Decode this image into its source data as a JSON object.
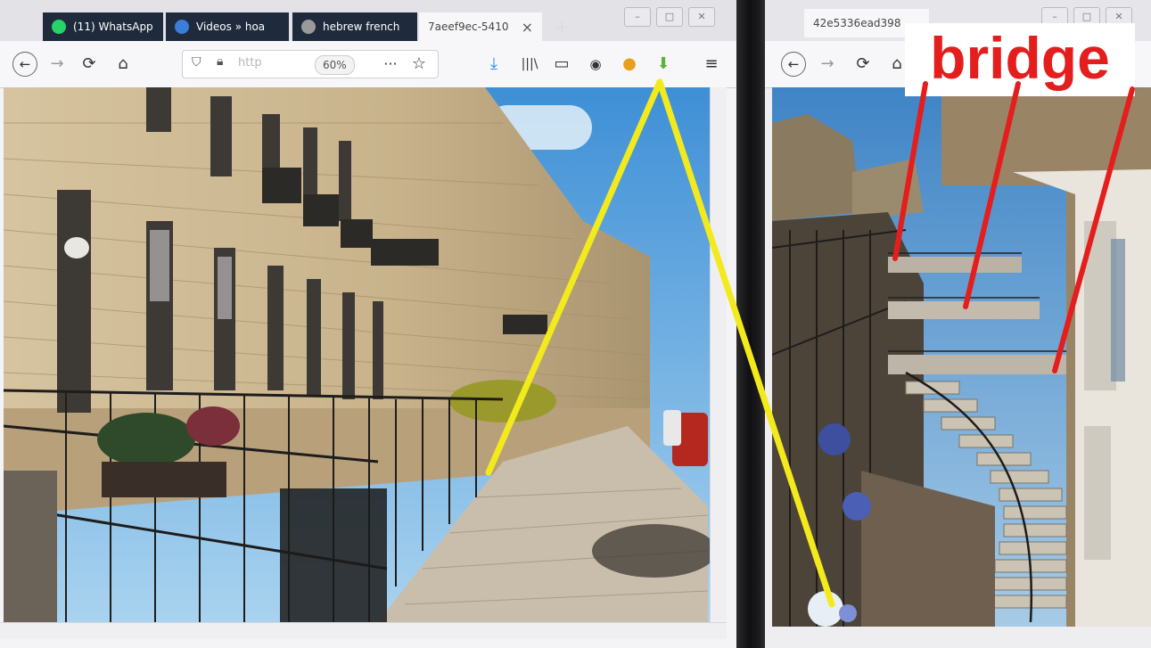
{
  "left_window": {
    "tabs": [
      {
        "label": "(11) WhatsApp",
        "icon": "whatsapp-icon",
        "color": "#25d366"
      },
      {
        "label": "Videos » hoa",
        "icon": "generic-site-icon",
        "color": "#3b7dd8"
      },
      {
        "label": "hebrew french",
        "icon": "generic-site-icon",
        "color": "#8a8a8a"
      },
      {
        "label": "7aeef9ec-5410",
        "icon": "document-icon",
        "color": "#ffffff"
      }
    ],
    "tab_close": "×",
    "new_tab": "+",
    "url_text": "http",
    "zoom": "60%",
    "more": "···"
  },
  "right_window": {
    "tab_label": "42e5336ead398",
    "annotation": "bridge"
  },
  "colors": {
    "annotation_red": "#e41d1d",
    "annotation_yellow": "#f2ea1c",
    "toolbar_blue": "#2a8ae0"
  }
}
